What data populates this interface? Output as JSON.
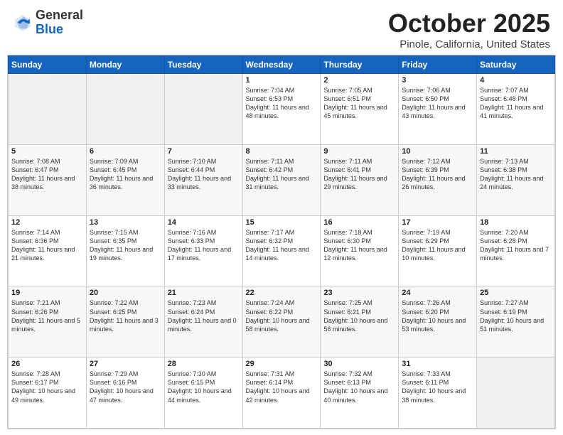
{
  "header": {
    "logo": {
      "general": "General",
      "blue": "Blue"
    },
    "title": "October 2025",
    "location": "Pinole, California, United States"
  },
  "days_of_week": [
    "Sunday",
    "Monday",
    "Tuesday",
    "Wednesday",
    "Thursday",
    "Friday",
    "Saturday"
  ],
  "weeks": [
    [
      {
        "day": "",
        "info": ""
      },
      {
        "day": "",
        "info": ""
      },
      {
        "day": "",
        "info": ""
      },
      {
        "day": "1",
        "info": "Sunrise: 7:04 AM\nSunset: 6:53 PM\nDaylight: 11 hours and 48 minutes."
      },
      {
        "day": "2",
        "info": "Sunrise: 7:05 AM\nSunset: 6:51 PM\nDaylight: 11 hours and 45 minutes."
      },
      {
        "day": "3",
        "info": "Sunrise: 7:06 AM\nSunset: 6:50 PM\nDaylight: 11 hours and 43 minutes."
      },
      {
        "day": "4",
        "info": "Sunrise: 7:07 AM\nSunset: 6:48 PM\nDaylight: 11 hours and 41 minutes."
      }
    ],
    [
      {
        "day": "5",
        "info": "Sunrise: 7:08 AM\nSunset: 6:47 PM\nDaylight: 11 hours and 38 minutes."
      },
      {
        "day": "6",
        "info": "Sunrise: 7:09 AM\nSunset: 6:45 PM\nDaylight: 11 hours and 36 minutes."
      },
      {
        "day": "7",
        "info": "Sunrise: 7:10 AM\nSunset: 6:44 PM\nDaylight: 11 hours and 33 minutes."
      },
      {
        "day": "8",
        "info": "Sunrise: 7:11 AM\nSunset: 6:42 PM\nDaylight: 11 hours and 31 minutes."
      },
      {
        "day": "9",
        "info": "Sunrise: 7:11 AM\nSunset: 6:41 PM\nDaylight: 11 hours and 29 minutes."
      },
      {
        "day": "10",
        "info": "Sunrise: 7:12 AM\nSunset: 6:39 PM\nDaylight: 11 hours and 26 minutes."
      },
      {
        "day": "11",
        "info": "Sunrise: 7:13 AM\nSunset: 6:38 PM\nDaylight: 11 hours and 24 minutes."
      }
    ],
    [
      {
        "day": "12",
        "info": "Sunrise: 7:14 AM\nSunset: 6:36 PM\nDaylight: 11 hours and 21 minutes."
      },
      {
        "day": "13",
        "info": "Sunrise: 7:15 AM\nSunset: 6:35 PM\nDaylight: 11 hours and 19 minutes."
      },
      {
        "day": "14",
        "info": "Sunrise: 7:16 AM\nSunset: 6:33 PM\nDaylight: 11 hours and 17 minutes."
      },
      {
        "day": "15",
        "info": "Sunrise: 7:17 AM\nSunset: 6:32 PM\nDaylight: 11 hours and 14 minutes."
      },
      {
        "day": "16",
        "info": "Sunrise: 7:18 AM\nSunset: 6:30 PM\nDaylight: 11 hours and 12 minutes."
      },
      {
        "day": "17",
        "info": "Sunrise: 7:19 AM\nSunset: 6:29 PM\nDaylight: 11 hours and 10 minutes."
      },
      {
        "day": "18",
        "info": "Sunrise: 7:20 AM\nSunset: 6:28 PM\nDaylight: 11 hours and 7 minutes."
      }
    ],
    [
      {
        "day": "19",
        "info": "Sunrise: 7:21 AM\nSunset: 6:26 PM\nDaylight: 11 hours and 5 minutes."
      },
      {
        "day": "20",
        "info": "Sunrise: 7:22 AM\nSunset: 6:25 PM\nDaylight: 11 hours and 3 minutes."
      },
      {
        "day": "21",
        "info": "Sunrise: 7:23 AM\nSunset: 6:24 PM\nDaylight: 11 hours and 0 minutes."
      },
      {
        "day": "22",
        "info": "Sunrise: 7:24 AM\nSunset: 6:22 PM\nDaylight: 10 hours and 58 minutes."
      },
      {
        "day": "23",
        "info": "Sunrise: 7:25 AM\nSunset: 6:21 PM\nDaylight: 10 hours and 56 minutes."
      },
      {
        "day": "24",
        "info": "Sunrise: 7:26 AM\nSunset: 6:20 PM\nDaylight: 10 hours and 53 minutes."
      },
      {
        "day": "25",
        "info": "Sunrise: 7:27 AM\nSunset: 6:19 PM\nDaylight: 10 hours and 51 minutes."
      }
    ],
    [
      {
        "day": "26",
        "info": "Sunrise: 7:28 AM\nSunset: 6:17 PM\nDaylight: 10 hours and 49 minutes."
      },
      {
        "day": "27",
        "info": "Sunrise: 7:29 AM\nSunset: 6:16 PM\nDaylight: 10 hours and 47 minutes."
      },
      {
        "day": "28",
        "info": "Sunrise: 7:30 AM\nSunset: 6:15 PM\nDaylight: 10 hours and 44 minutes."
      },
      {
        "day": "29",
        "info": "Sunrise: 7:31 AM\nSunset: 6:14 PM\nDaylight: 10 hours and 42 minutes."
      },
      {
        "day": "30",
        "info": "Sunrise: 7:32 AM\nSunset: 6:13 PM\nDaylight: 10 hours and 40 minutes."
      },
      {
        "day": "31",
        "info": "Sunrise: 7:33 AM\nSunset: 6:11 PM\nDaylight: 10 hours and 38 minutes."
      },
      {
        "day": "",
        "info": ""
      }
    ]
  ]
}
